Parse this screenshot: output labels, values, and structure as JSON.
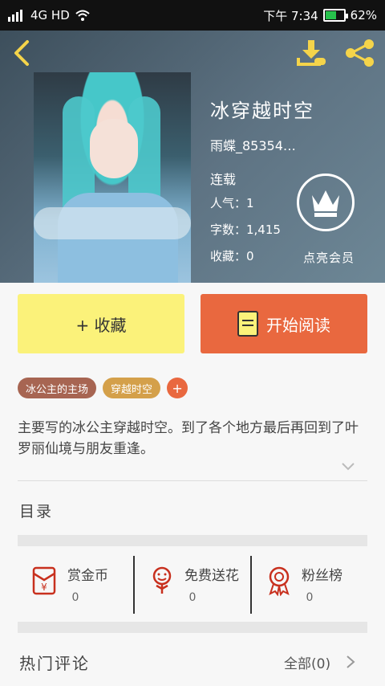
{
  "status_bar": {
    "network": "4G HD",
    "time": "下午 7:34",
    "battery": "62%",
    "battery_level": 0.62
  },
  "book": {
    "title": "冰穿越时空",
    "author": "雨蝶_85354…",
    "status": "连载",
    "popularity": "人气：1",
    "word_count": "字数：1,415",
    "favorites": "收藏：0",
    "vip_label": "点亮会员"
  },
  "actions": {
    "favorite_label": "+ 收藏",
    "read_label": "开始阅读"
  },
  "tags": [
    "冰公主的主场",
    "穿越时空"
  ],
  "tag_add": "+",
  "description": "主要写的冰公主穿越时空。到了各个地方最后再回到了叶罗丽仙境与朋友重逢。",
  "toc_label": "目录",
  "tiles": [
    {
      "label": "赏金币",
      "count": "0",
      "icon": "red-envelope-icon"
    },
    {
      "label": "免费送花",
      "count": "0",
      "icon": "flower-icon"
    },
    {
      "label": "粉丝榜",
      "count": "0",
      "icon": "medal-icon"
    }
  ],
  "comments": {
    "title": "热门评论",
    "all_label": "全部(0)"
  },
  "colors": {
    "read_button": "#e9683f",
    "favorite_button": "#fbf27a",
    "accent_icon": "#c8301e",
    "tag_1": "#a76552",
    "tag_2": "#d4a04a"
  }
}
